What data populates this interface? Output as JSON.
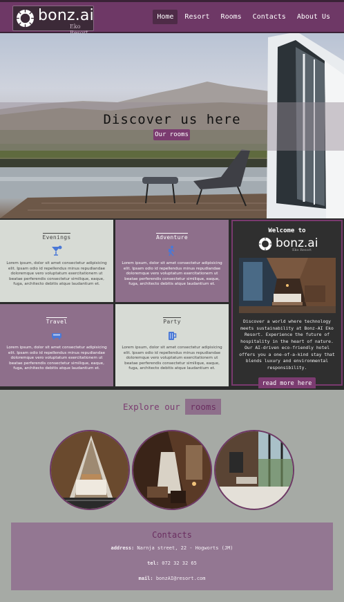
{
  "header": {
    "logo_text": "bonz.ai",
    "logo_sub": "Eko Resort",
    "nav": [
      "Home",
      "Resort",
      "Rooms",
      "Contacts",
      "About Us"
    ],
    "active_nav": "Home"
  },
  "hero": {
    "title": "Discover us here",
    "button": "Our rooms"
  },
  "activities": [
    {
      "title": "Evenings",
      "icon": "cocktail-icon",
      "text": "Lorem ipsum, dolor sit amet consectetur adipisicing elit. Ipsam odio id repellendus minus repudiandae doloremque vero voluptatum exercitationem ut beatae perferendis consectetur similique, eaque, fuga, architecto debitis atque laudantium et."
    },
    {
      "title": "Adventure",
      "icon": "hiker-icon",
      "text": "Lorem ipsum, dolor sit amet consectetur adipisicing elit. Ipsam odio id repellendus minus repudiandae doloremque vero voluptatum exercitationem ut beatae perferendis consectetur similique, eaque, fuga, architecto debitis atque laudantium et."
    },
    {
      "title": "Travel",
      "icon": "bus-icon",
      "text": "Lorem ipsum, dolor sit amet consectetur adipisicing elit. Ipsam odio id repellendus minus repudiandae doloremque vero voluptatum exercitationem ut beatae perferendis consectetur similique, eaque, fuga, architecto debitis atque laudantium et."
    },
    {
      "title": "Party",
      "icon": "beer-icon",
      "text": "Lorem ipsum, dolor sit amet consectetur adipisicing elit. Ipsam odio id repellendus minus repudiandae doloremque vero voluptatum exercitationem ut beatae perferendis consectetur similique, eaque, fuga, architecto debitis atque laudantium et."
    }
  ],
  "welcome": {
    "title": "Welcome to",
    "logo_text": "bonz.ai",
    "logo_sub": "Eko Resort",
    "text": "Discover a world where technology meets sustainability at Bonz-AI Eko Resort. Experience the future of hospitality in the heart of nature. Our AI-driven eco-friendly hotel offers you a one-of-a-kind stay that blends luxury and environmental responsibility.",
    "button": "read more here"
  },
  "rooms": {
    "title_prefix": "Explore our",
    "title_highlight": "rooms"
  },
  "contacts": {
    "title": "Contacts",
    "address_label": "address:",
    "address": "Narnja street, 22 - Hogworts (JM)",
    "tel_label": "tel:",
    "tel": "072 32 32 65",
    "mail_label": "mail:",
    "mail": "bonzAI@resort.com"
  },
  "colors": {
    "brand": "#6e3866",
    "accent": "#7b3b70",
    "tile_purple": "#8e6f8b",
    "tile_light": "#d7dbd5"
  }
}
